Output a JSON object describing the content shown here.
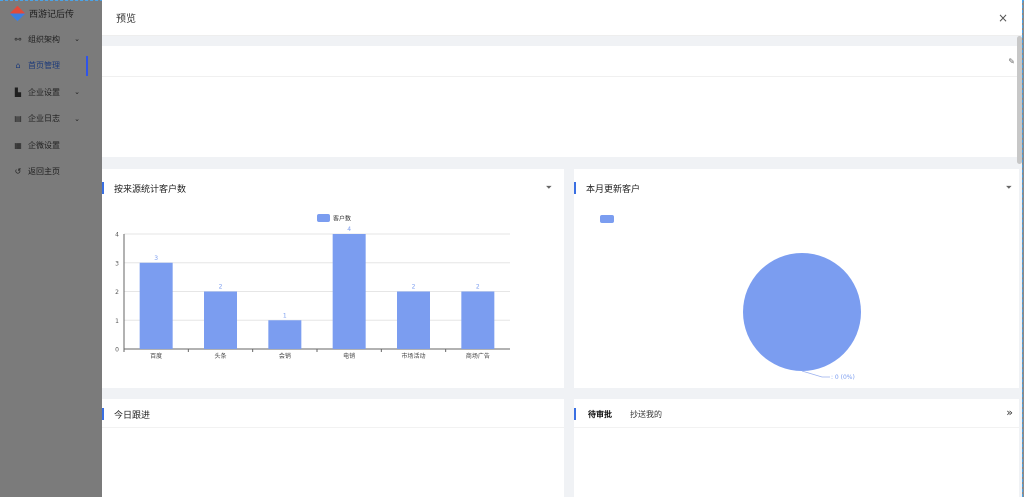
{
  "app": {
    "brand": "西游记后传",
    "nav": [
      {
        "label": "组织架构",
        "icon": "org-icon",
        "glyph": "⚯",
        "chevron": true
      },
      {
        "label": "首页管理",
        "icon": "home-icon",
        "glyph": "⌂",
        "chevron": false,
        "active": true
      },
      {
        "label": "企业设置",
        "icon": "building-icon",
        "glyph": "▙",
        "chevron": true
      },
      {
        "label": "企业日志",
        "icon": "log-icon",
        "glyph": "▤",
        "chevron": true
      },
      {
        "label": "企微设置",
        "icon": "grid-icon",
        "glyph": "▦",
        "chevron": false
      },
      {
        "label": "返回主页",
        "icon": "back-icon",
        "glyph": "↺",
        "chevron": false
      }
    ]
  },
  "drawer": {
    "title": "预览",
    "close": "×"
  },
  "cards": {
    "source_title": "按来源统计客户数",
    "monthly_title": "本月更新客户",
    "followup_title": "今日跟进",
    "tabs": [
      "待审批",
      "抄送我的"
    ]
  },
  "colors": {
    "accent": "#3a6fe2",
    "series": "#7b9df0"
  },
  "chart_data": [
    {
      "type": "bar",
      "categories": [
        "百度",
        "头条",
        "会销",
        "电销",
        "市场活动",
        "商场广告"
      ],
      "series": [
        {
          "name": "客户数",
          "values": [
            3,
            2,
            1,
            4,
            2,
            2
          ]
        }
      ],
      "ylim": [
        0,
        4
      ],
      "yticks": [
        "0",
        "1",
        "2",
        "3",
        "4"
      ],
      "legend": "top-center",
      "grid": true
    },
    {
      "type": "pie",
      "slices": [
        {
          "label": "",
          "value": 0,
          "percent": "(0%)"
        }
      ],
      "slice_label": ": 0 (0%)",
      "legend": "top-left"
    }
  ]
}
